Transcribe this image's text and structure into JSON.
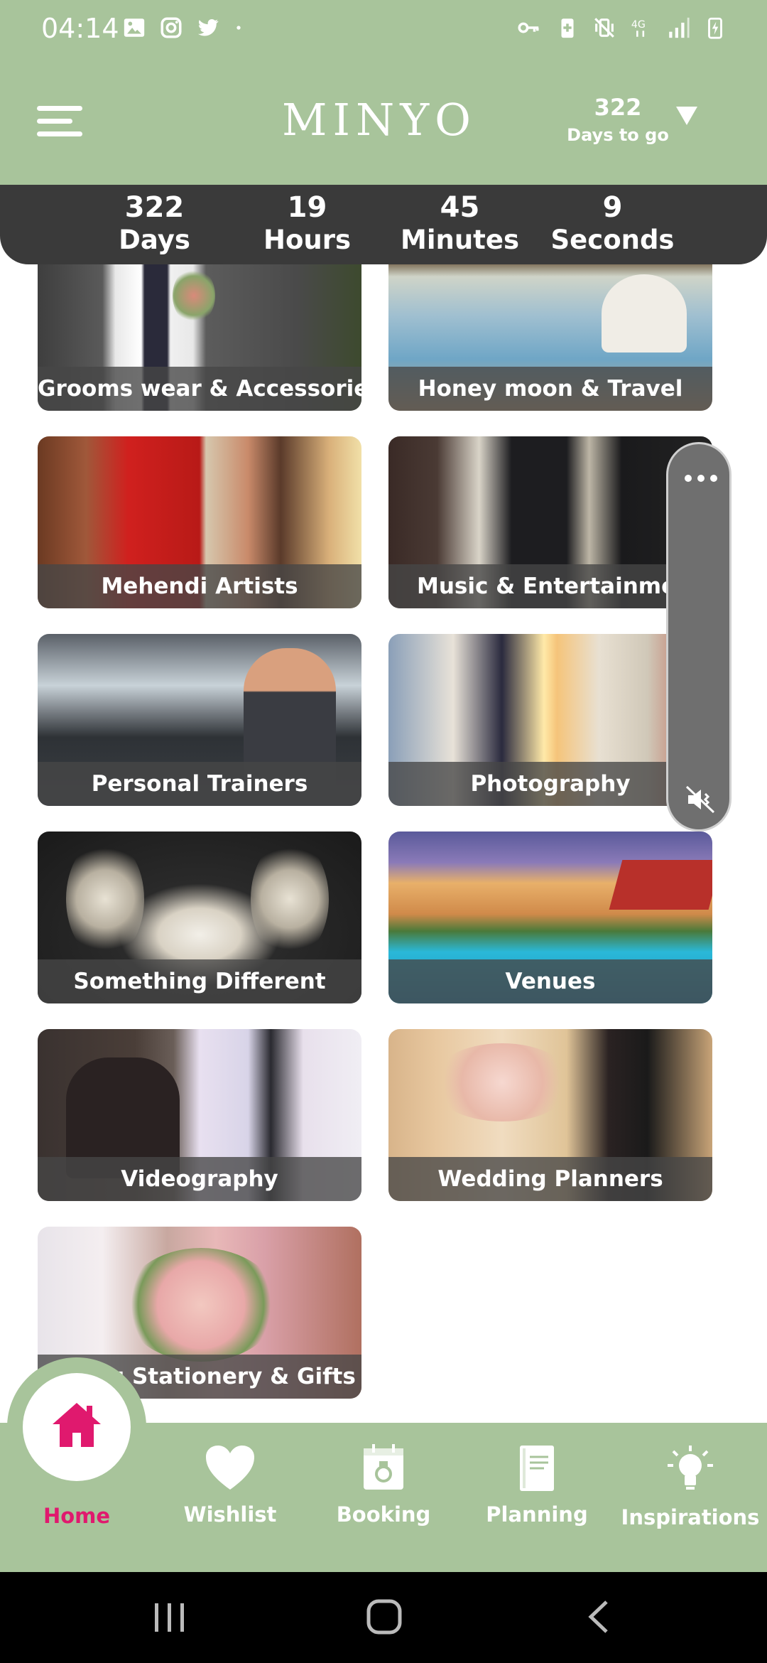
{
  "status_bar": {
    "time": "04:14",
    "left_icons": [
      "gallery-icon",
      "instagram-icon",
      "twitter-icon",
      "dot-icon"
    ],
    "right_icons": [
      "vpn-key-icon",
      "battery-saver-icon",
      "vibrate-mute-icon",
      "4g-signal-icon",
      "signal-bars-icon",
      "battery-charging-icon"
    ]
  },
  "header": {
    "logo": "MINYO",
    "days_count": "322",
    "days_label": "Days to go"
  },
  "countdown": [
    {
      "value": "322",
      "label": "Days"
    },
    {
      "value": "19",
      "label": "Hours"
    },
    {
      "value": "45",
      "label": "Minutes"
    },
    {
      "value": "9",
      "label": "Seconds"
    }
  ],
  "categories": [
    {
      "label": "Grooms wear & Accessories"
    },
    {
      "label": "Honey moon & Travel"
    },
    {
      "label": "Mehendi Artists"
    },
    {
      "label": "Music & Entertainmer"
    },
    {
      "label": "Personal Trainers"
    },
    {
      "label": "Photography"
    },
    {
      "label": "Something Different"
    },
    {
      "label": "Venues"
    },
    {
      "label": "Videography"
    },
    {
      "label": "Wedding Planners"
    },
    {
      "label": "g Stationery & Gifts"
    }
  ],
  "bottom_nav": {
    "items": [
      {
        "label": "Home",
        "icon": "home-icon",
        "active": true
      },
      {
        "label": "Wishlist",
        "icon": "heart-icon"
      },
      {
        "label": "Booking",
        "icon": "calendar-icon"
      },
      {
        "label": "Planning",
        "icon": "book-icon"
      },
      {
        "label": "Inspirations",
        "icon": "lightbulb-icon"
      }
    ]
  },
  "colors": {
    "brand_green": "#a8c49b",
    "countdown_bg": "#3a3a3a",
    "active_pink": "#e0196e"
  }
}
